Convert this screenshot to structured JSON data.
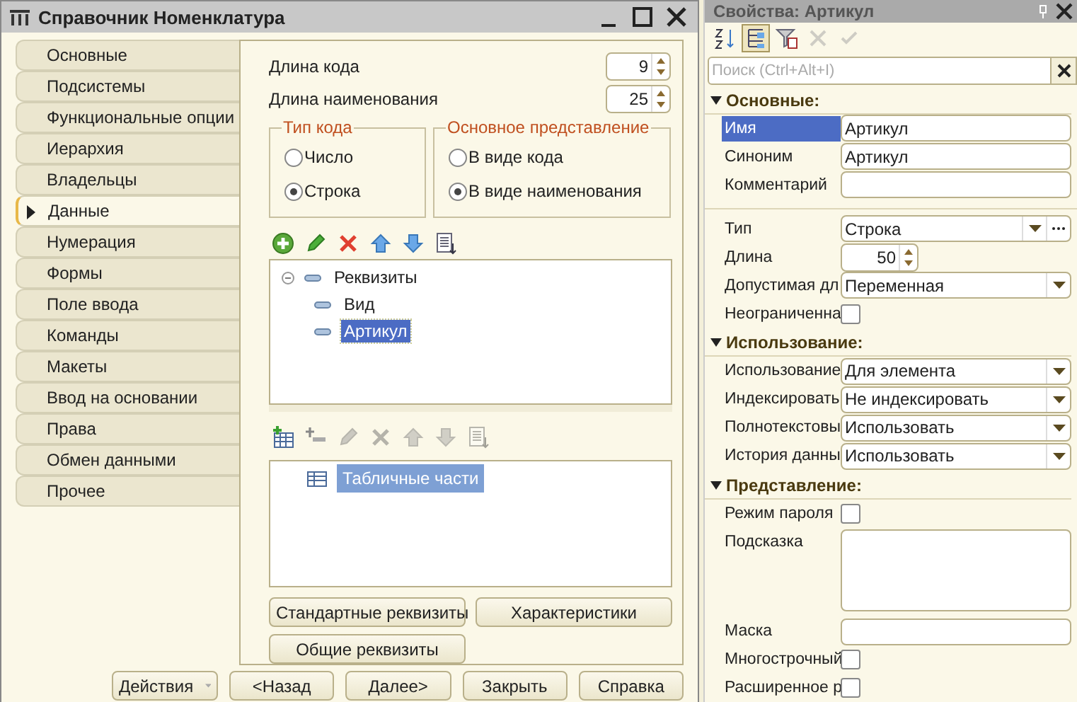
{
  "window": {
    "title": "Справочник Номенклатура"
  },
  "tabs": [
    {
      "label": "Основные",
      "selected": false
    },
    {
      "label": "Подсистемы",
      "selected": false
    },
    {
      "label": "Функциональные опции",
      "selected": false
    },
    {
      "label": "Иерархия",
      "selected": false
    },
    {
      "label": "Владельцы",
      "selected": false
    },
    {
      "label": "Данные",
      "selected": true
    },
    {
      "label": "Нумерация",
      "selected": false
    },
    {
      "label": "Формы",
      "selected": false
    },
    {
      "label": "Поле ввода",
      "selected": false
    },
    {
      "label": "Команды",
      "selected": false
    },
    {
      "label": "Макеты",
      "selected": false
    },
    {
      "label": "Ввод на основании",
      "selected": false
    },
    {
      "label": "Права",
      "selected": false
    },
    {
      "label": "Обмен данными",
      "selected": false
    },
    {
      "label": "Прочее",
      "selected": false
    }
  ],
  "length_fields": [
    {
      "label": "Длина кода",
      "value": "9"
    },
    {
      "label": "Длина наименования",
      "value": "25"
    }
  ],
  "radio_groups": [
    {
      "title": "Тип кода",
      "options": [
        {
          "label": "Число",
          "selected": false
        },
        {
          "label": "Строка",
          "selected": true
        }
      ]
    },
    {
      "title": "Основное представление",
      "options": [
        {
          "label": "В виде кода",
          "selected": false
        },
        {
          "label": "В виде наименования",
          "selected": true
        }
      ]
    }
  ],
  "attributes_toolbar": [
    {
      "kind": "add",
      "disabled": false
    },
    {
      "kind": "edit",
      "disabled": false
    },
    {
      "kind": "delete",
      "disabled": false
    },
    {
      "kind": "up",
      "disabled": false
    },
    {
      "kind": "down",
      "disabled": false
    },
    {
      "kind": "sort",
      "disabled": false
    }
  ],
  "attributes_tree": [
    {
      "label": "Реквизиты",
      "expanded": true,
      "selected": false,
      "children": [
        {
          "label": "Вид",
          "selected": false
        },
        {
          "label": "Артикул",
          "selected": true
        }
      ]
    }
  ],
  "tables_toolbar": [
    {
      "kind": "add_table",
      "disabled": false
    },
    {
      "kind": "add_attr",
      "disabled": false
    },
    {
      "kind": "edit",
      "disabled": true
    },
    {
      "kind": "delete",
      "disabled": true
    },
    {
      "kind": "up",
      "disabled": true
    },
    {
      "kind": "down",
      "disabled": true
    },
    {
      "kind": "sort",
      "disabled": true
    }
  ],
  "tables_tree": [
    {
      "label": "Табличные части",
      "selected": true
    }
  ],
  "panel_buttons": [
    "Стандартные реквизиты",
    "Характеристики",
    "Общие реквизиты"
  ],
  "footer_buttons": [
    {
      "label": "Действия",
      "kind": "menu"
    },
    {
      "label": "<Назад",
      "kind": "plain"
    },
    {
      "label": "Далее>",
      "kind": "plain"
    },
    {
      "label": "Закрыть",
      "kind": "plain"
    },
    {
      "label": "Справка",
      "kind": "plain"
    }
  ],
  "properties": {
    "title": "Свойства: Артикул",
    "search": {
      "placeholder": "Поиск (Ctrl+Alt+I)"
    },
    "toolbar": [
      {
        "kind": "sort_alpha",
        "selected": false,
        "disabled": false
      },
      {
        "kind": "categories",
        "selected": true,
        "disabled": false
      },
      {
        "kind": "filter",
        "selected": false,
        "disabled": false
      },
      {
        "kind": "cancel",
        "selected": false,
        "disabled": true
      },
      {
        "kind": "apply",
        "selected": false,
        "disabled": true
      }
    ],
    "sections": [
      {
        "title": "Основные:",
        "expanded": true,
        "groups": [
          {
            "rows": [
              {
                "label": "Имя",
                "kind": "text",
                "value": "Артикул",
                "selected": true
              },
              {
                "label": "Синоним",
                "kind": "text",
                "value": "Артикул",
                "selected": false
              },
              {
                "label": "Комментарий",
                "kind": "text",
                "selected": false
              }
            ]
          },
          {
            "rows": [
              {
                "label": "Тип",
                "kind": "select_more",
                "value": "Строка",
                "selected": false
              },
              {
                "label": "Длина",
                "kind": "spin",
                "value": "50",
                "selected": false
              },
              {
                "label": "Допустимая дл",
                "kind": "select",
                "value": "Переменная",
                "selected": false
              },
              {
                "label": "Неограниченна",
                "kind": "checkbox",
                "checked": false,
                "selected": false
              }
            ]
          }
        ]
      },
      {
        "title": "Использование:",
        "expanded": true,
        "groups": [
          {
            "rows": [
              {
                "label": "Использование",
                "kind": "select",
                "value": "Для элемента",
                "selected": false
              },
              {
                "label": "Индексировать",
                "kind": "select",
                "value": "Не индексировать",
                "selected": false
              },
              {
                "label": "Полнотекстовы",
                "kind": "select",
                "value": "Использовать",
                "selected": false
              },
              {
                "label": "История данны",
                "kind": "select",
                "value": "Использовать",
                "selected": false
              }
            ]
          }
        ]
      },
      {
        "title": "Представление:",
        "expanded": true,
        "groups": [
          {
            "rows": [
              {
                "label": "Режим пароля",
                "kind": "checkbox",
                "checked": false,
                "selected": false
              },
              {
                "label": "Подсказка",
                "kind": "textarea",
                "selected": false
              },
              {
                "label": "Маска",
                "kind": "text",
                "selected": false
              },
              {
                "label": "Многострочный",
                "kind": "checkbox",
                "checked": false,
                "selected": false
              },
              {
                "label": "Расширенное р",
                "kind": "checkbox",
                "checked": false,
                "selected": false
              }
            ]
          }
        ]
      }
    ]
  }
}
